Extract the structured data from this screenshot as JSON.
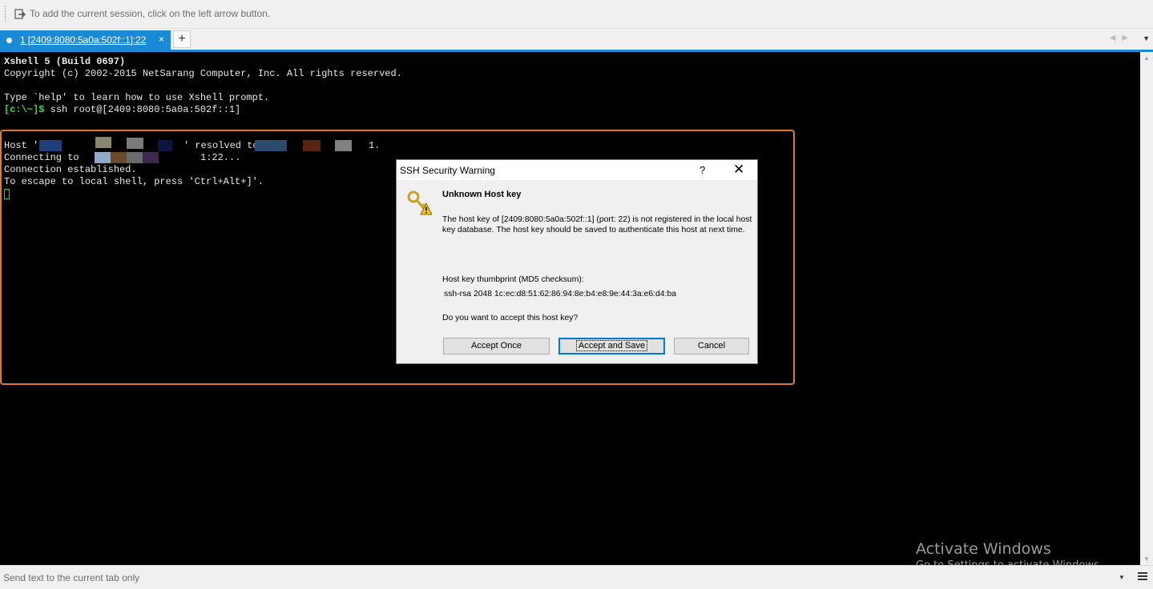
{
  "hint": {
    "text": "To add the current session, click on the left arrow button."
  },
  "tabs": [
    {
      "label": "1 [2409:8080:5a0a:502f::1]:22",
      "close": "×"
    }
  ],
  "new_tab_label": "+",
  "terminal": {
    "lines": {
      "l1": "Xshell 5 (Build 0697)",
      "l2": "Copyright (c) 2002-2015 NetSarang Computer, Inc. All rights reserved.",
      "l3": "Type `help' to learn how to use Xshell prompt.",
      "prompt": "[c:\\~]$",
      "command": " ssh root@[2409:8080:5a0a:502f::1]",
      "host_a": "Host '",
      "host_b": "' resolved to",
      "host_c": "1.",
      "connecting_a": "Connecting to",
      "connecting_b": "1:22...",
      "established": "Connection established.",
      "escape": "To escape to local shell, press 'Ctrl+Alt+]'."
    }
  },
  "dialog": {
    "title": "SSH Security Warning",
    "help": "?",
    "close": "✕",
    "heading": "Unknown Host key",
    "body": "The host key of [2409:8080:5a0a:502f::1] (port: 22) is not registered in the local host key database. The host key should be saved to authenticate this host at next time.",
    "thumbprint_label": "Host key thumbprint (MD5 checksum):",
    "thumbprint_value": "ssh-rsa 2048 1c:ec:d8:51:62:86:94:8e:b4:e8:9e:44:3a:e6:d4:ba",
    "question": "Do you want to accept this host key?",
    "buttons": {
      "accept_once": "Accept Once",
      "accept_save": "Accept and Save",
      "cancel": "Cancel"
    }
  },
  "send_bar": {
    "placeholder": "Send text to the current tab only"
  },
  "watermark": {
    "title": "Activate Windows",
    "subtitle": "Go to Settings to activate Windows."
  },
  "colors": {
    "accent": "#1a8ad6",
    "highlight_border": "#e07a2b",
    "prompt": "#3ddc3d",
    "terminal_bg": "#000000"
  }
}
